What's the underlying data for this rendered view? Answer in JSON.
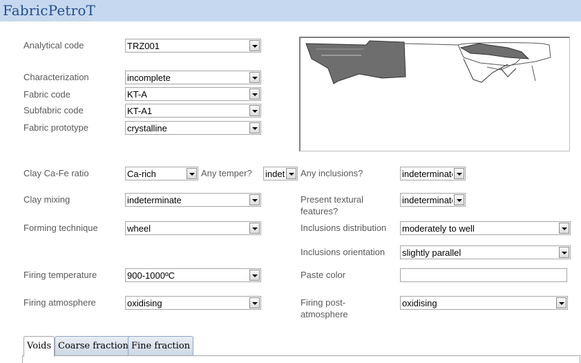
{
  "app": {
    "title": "FabricPetroT"
  },
  "form": {
    "analytical_code": {
      "label": "Analytical code",
      "value": "TRZ001"
    },
    "characterization": {
      "label": "Characterization",
      "value": "incomplete"
    },
    "fabric_code": {
      "label": "Fabric code",
      "value": "KT-A"
    },
    "subfabric_code": {
      "label": "Subfabric code",
      "value": "KT-A1"
    },
    "fabric_prototype": {
      "label": "Fabric prototype",
      "value": "crystalline"
    },
    "clay_ca_fe_ratio": {
      "label": "Clay Ca-Fe ratio",
      "value": "Ca-rich"
    },
    "any_temper": {
      "label": "Any temper?",
      "value": "indeterminate"
    },
    "any_inclusions": {
      "label": "Any inclusions?",
      "value": "indeterminate"
    },
    "clay_mixing": {
      "label": "Clay mixing",
      "value": "indeterminate"
    },
    "present_textural_features": {
      "label_line1": "Present textural",
      "label_line2": "features?",
      "value": "indeterminate"
    },
    "forming_technique": {
      "label": "Forming technique",
      "value": "wheel"
    },
    "inclusions_distribution": {
      "label": "Inclusions distribution",
      "value": "moderately to well"
    },
    "inclusions_orientation": {
      "label": "Inclusions orientation",
      "value": "slightly parallel"
    },
    "firing_temperature": {
      "label": "Firing temperature",
      "value": "900-1000ºC"
    },
    "paste_color": {
      "label": "Paste color",
      "value": ""
    },
    "firing_atmosphere": {
      "label": "Firing atmosphere",
      "value": "oxidising"
    },
    "firing_post_atmosphere": {
      "label_line1": "Firing post-",
      "label_line2": "atmosphere",
      "value": "oxidising"
    }
  },
  "tabs": [
    {
      "label": "Voids",
      "active": true
    },
    {
      "label": "Coarse fraction",
      "active": false
    },
    {
      "label": "Fine fraction",
      "active": false
    }
  ],
  "colors": {
    "titlebar": "#c6d8ef",
    "title_text": "#1f4e8c",
    "sherd_fill": "#6e6e6e"
  },
  "image": {
    "subject": "ceramic sherd profile drawing"
  }
}
